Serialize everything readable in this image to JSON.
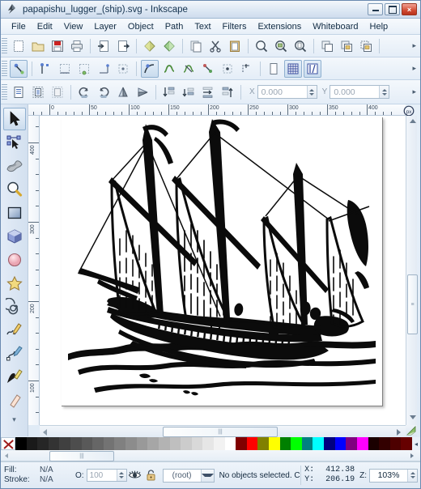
{
  "window": {
    "title": "papapishu_lugger_(ship).svg - Inkscape",
    "app_icon": "inkscape-logo-icon",
    "buttons": {
      "minimize": "minimize-icon",
      "maximize": "maximize-icon",
      "close": "×"
    }
  },
  "menubar": {
    "items": [
      {
        "label": "File"
      },
      {
        "label": "Edit"
      },
      {
        "label": "View"
      },
      {
        "label": "Layer"
      },
      {
        "label": "Object"
      },
      {
        "label": "Path"
      },
      {
        "label": "Text"
      },
      {
        "label": "Filters"
      },
      {
        "label": "Extensions"
      },
      {
        "label": "Whiteboard"
      },
      {
        "label": "Help"
      }
    ]
  },
  "command_toolbar": {
    "overflow": "▸",
    "items": [
      {
        "name": "new-document-button",
        "icon": "new-document-icon"
      },
      {
        "name": "open-document-button",
        "icon": "open-folder-icon"
      },
      {
        "name": "save-document-button",
        "icon": "save-floppy-icon"
      },
      {
        "name": "print-document-button",
        "icon": "printer-icon"
      },
      {
        "name": "import-button",
        "icon": "import-icon"
      },
      {
        "name": "export-button",
        "icon": "export-icon"
      },
      {
        "name": "undo-button",
        "icon": "undo-arrow-icon"
      },
      {
        "name": "redo-button",
        "icon": "redo-arrow-icon"
      },
      {
        "name": "copy-button",
        "icon": "copy-icon"
      },
      {
        "name": "cut-button",
        "icon": "scissors-icon"
      },
      {
        "name": "paste-button",
        "icon": "clipboard-paste-icon"
      },
      {
        "name": "zoom-selection-button",
        "icon": "zoom-selection-icon"
      },
      {
        "name": "zoom-drawing-button",
        "icon": "zoom-drawing-icon"
      },
      {
        "name": "zoom-page-button",
        "icon": "zoom-page-icon"
      },
      {
        "name": "duplicate-button",
        "icon": "duplicate-icon"
      },
      {
        "name": "group-button",
        "icon": "group-icon"
      },
      {
        "name": "ungroup-button",
        "icon": "ungroup-icon"
      }
    ]
  },
  "snap_toolbar": {
    "overflow": "▸",
    "items": [
      {
        "name": "snap-enable-toggle",
        "icon": "snap-magnet-icon",
        "selected": true
      },
      {
        "name": "snap-bounding-box-button",
        "icon": "snap-bbox-icon"
      },
      {
        "name": "snap-bbox-edge-button",
        "icon": "snap-bbox-edge-icon"
      },
      {
        "name": "snap-bbox-corner-button",
        "icon": "snap-bbox-corner-icon"
      },
      {
        "name": "snap-bbox-edge-midpoint-button",
        "icon": "snap-edge-mid-icon"
      },
      {
        "name": "snap-bbox-center-button",
        "icon": "snap-bbox-center-icon"
      },
      {
        "name": "snap-nodes-toggle",
        "icon": "snap-node-icon",
        "selected": true
      },
      {
        "name": "snap-path-button",
        "icon": "snap-path-icon"
      },
      {
        "name": "snap-path-intersection-button",
        "icon": "snap-path-intersect-icon"
      },
      {
        "name": "snap-to-node-button",
        "icon": "snap-to-node-icon"
      },
      {
        "name": "snap-cusp-node-button",
        "icon": "snap-cusp-icon"
      },
      {
        "name": "snap-smooth-node-button",
        "icon": "snap-smooth-icon"
      },
      {
        "name": "snap-page-border-button",
        "icon": "snap-page-border-icon"
      },
      {
        "name": "snap-grid-toggle",
        "icon": "snap-grid-icon",
        "selected": true
      },
      {
        "name": "snap-guide-toggle",
        "icon": "snap-guide-icon",
        "selected": true
      }
    ]
  },
  "tool_options_toolbar": {
    "overflow": "▸",
    "x_label": "X",
    "x_value": "0.000",
    "y_label": "Y",
    "y_value": "0.000",
    "items": [
      {
        "name": "select-all-button",
        "icon": "select-all-icon"
      },
      {
        "name": "select-all-layers-button",
        "icon": "select-all-layers-icon"
      },
      {
        "name": "deselect-button",
        "icon": "deselect-icon"
      },
      {
        "name": "rotate-ccw-button",
        "icon": "rotate-ccw-icon"
      },
      {
        "name": "rotate-cw-button",
        "icon": "rotate-cw-icon"
      },
      {
        "name": "flip-horizontal-button",
        "icon": "flip-horizontal-icon"
      },
      {
        "name": "flip-vertical-button",
        "icon": "flip-vertical-icon"
      },
      {
        "name": "lower-to-bottom-button",
        "icon": "lower-to-bottom-icon"
      },
      {
        "name": "lower-button",
        "icon": "lower-icon"
      },
      {
        "name": "raise-button",
        "icon": "raise-icon"
      },
      {
        "name": "raise-to-top-button",
        "icon": "raise-to-top-icon"
      }
    ]
  },
  "toolbox": {
    "more": "▾",
    "tools": [
      {
        "name": "tool-selector",
        "icon": "arrow-cursor-icon",
        "selected": true
      },
      {
        "name": "tool-node-editor",
        "icon": "node-editor-icon",
        "selected": false
      },
      {
        "name": "tool-tweak",
        "icon": "tweak-icon",
        "selected": false
      },
      {
        "name": "tool-zoom",
        "icon": "magnifier-icon",
        "selected": false
      },
      {
        "name": "tool-rectangle",
        "icon": "rectangle-icon",
        "selected": false
      },
      {
        "name": "tool-3dbox",
        "icon": "cube-3d-icon",
        "selected": false
      },
      {
        "name": "tool-ellipse",
        "icon": "ellipse-icon",
        "selected": false
      },
      {
        "name": "tool-star",
        "icon": "star-icon",
        "selected": false
      },
      {
        "name": "tool-spiral",
        "icon": "spiral-icon",
        "selected": false
      },
      {
        "name": "tool-pencil",
        "icon": "pencil-icon",
        "selected": false
      },
      {
        "name": "tool-bezier",
        "icon": "bezier-pen-icon",
        "selected": false
      },
      {
        "name": "tool-calligraphy",
        "icon": "calligraphy-pen-icon",
        "selected": false
      },
      {
        "name": "tool-eraser",
        "icon": "eraser-icon",
        "selected": false
      }
    ]
  },
  "rulers": {
    "units": "px",
    "horizontal_ticks": [
      "0",
      "50",
      "100",
      "150",
      "200",
      "250",
      "300",
      "350",
      "400"
    ],
    "vertical_ticks": [
      "400",
      "300",
      "200",
      "100"
    ],
    "zoom_corner_icon": "ruler-unit-icon"
  },
  "canvas": {
    "artwork_name": "sailing-lugger-line-drawing",
    "background_color": "#ffffff"
  },
  "scrollbars": {
    "vertical_grip": "≡",
    "horizontal_grip": "|||",
    "up_arrow": "▲",
    "down_arrow": "▼",
    "left_arrow": "◂",
    "right_arrow": "▸",
    "gradient_corner_icon": "gradient-corner-icon"
  },
  "palette": {
    "none_swatch": "none-color-swatch",
    "more": "◂",
    "colors": [
      "#000000",
      "#1a1a1a",
      "#262626",
      "#333333",
      "#404040",
      "#4d4d4d",
      "#595959",
      "#666666",
      "#737373",
      "#808080",
      "#8c8c8c",
      "#999999",
      "#a6a6a6",
      "#b3b3b3",
      "#bfbfbf",
      "#cccccc",
      "#d9d9d9",
      "#e6e6e6",
      "#f2f2f2",
      "#ffffff",
      "#800000",
      "#ff0000",
      "#808000",
      "#ffff00",
      "#008000",
      "#00ff00",
      "#008080",
      "#00ffff",
      "#000080",
      "#0000ff",
      "#800080",
      "#ff00ff",
      "#1a0000",
      "#330000",
      "#4d0000",
      "#660000"
    ]
  },
  "statusbar": {
    "fill_label": "Fill:",
    "fill_value": "N/A",
    "stroke_label": "Stroke:",
    "stroke_value": "N/A",
    "opacity_label": "O:",
    "opacity_value": "100",
    "visibility_icon": "eye-icon",
    "lock_icon": "unlock-icon",
    "layer_name": "(root)",
    "message": "No objects selected. C",
    "x_label": "X:",
    "x_value": "412.38",
    "y_label": "Y:",
    "y_value": "206.19",
    "zoom_label": "Z:",
    "zoom_value": "103%"
  }
}
